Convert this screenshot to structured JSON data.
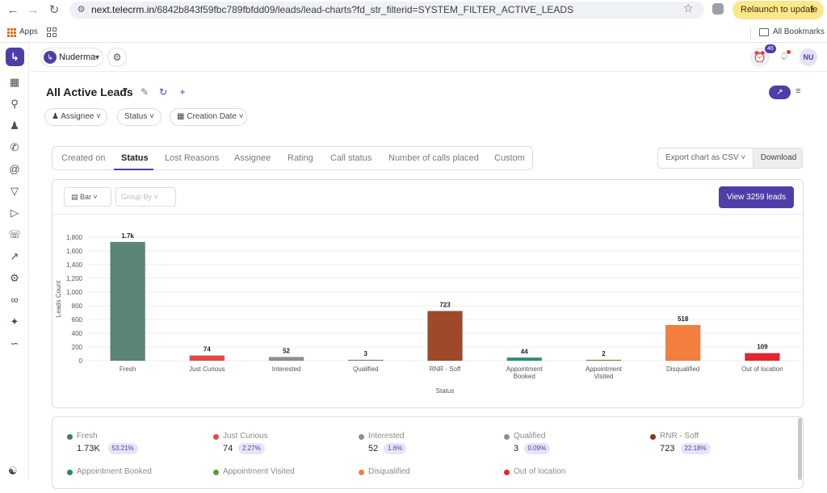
{
  "browser": {
    "url_host": "next.telecrm.in",
    "url_path": "/6842b843f59fbc789fbfdd09/leads/lead-charts?fd_str_filterid=SYSTEM_FILTER_ACTIVE_LEADS",
    "relaunch_label": "Relaunch to update",
    "bookmarks": {
      "apps_label": "Apps",
      "all_bookmarks_label": "All Bookmarks"
    }
  },
  "header": {
    "workspace_name": "Nuderma",
    "alarm_count": "46",
    "user_initials": "NU"
  },
  "page": {
    "title": "All Active Leads",
    "filters": [
      "Assignee",
      "Status",
      "Creation Date"
    ]
  },
  "tabs": {
    "items": [
      "Created on",
      "Status",
      "Lost Reasons",
      "Assignee",
      "Rating",
      "Call status",
      "Number of calls placed",
      "Custom"
    ],
    "active": "Status"
  },
  "export": {
    "select_label": "Export chart as CSV",
    "download_label": "Download"
  },
  "chart_toolbar": {
    "chart_type_label": "Bar",
    "group_by_placeholder": "Group By",
    "view_leads_label": "View 3259 leads"
  },
  "chart_data": {
    "type": "bar",
    "xlabel": "Status",
    "ylabel": "Leads Count",
    "ylim": [
      0,
      1800
    ],
    "yticks": [
      "0",
      "200",
      "400",
      "600",
      "800",
      "1,000",
      "1,200",
      "1,400",
      "1,600",
      "1,800"
    ],
    "categories": [
      "Fresh",
      "Just Curious",
      "Interested",
      "Qualified",
      "RNR - Soff",
      "Appointment Booked",
      "Appointment Visited",
      "Disqualified",
      "Out of location"
    ],
    "category_lines": [
      [
        "Fresh"
      ],
      [
        "Just Curious"
      ],
      [
        "Interested"
      ],
      [
        "Qualified"
      ],
      [
        "RNR - Soff"
      ],
      [
        "Appointment",
        "Booked"
      ],
      [
        "Appointment",
        "Visited"
      ],
      [
        "Disqualified"
      ],
      [
        "Out of location"
      ]
    ],
    "values": [
      1730,
      74,
      52,
      3,
      723,
      44,
      2,
      518,
      109
    ],
    "data_labels": [
      "1.7k",
      "74",
      "52",
      "3",
      "723",
      "44",
      "2",
      "518",
      "109"
    ],
    "colors": [
      "#5a8577",
      "#e5493f",
      "#8f8f8f",
      "#8f8f8f",
      "#9e4a2a",
      "#2f8f7a",
      "#6ea13e",
      "#f37f3f",
      "#e2262f"
    ],
    "grid": true,
    "legend": "bottom"
  },
  "legend": {
    "items": [
      {
        "name": "Fresh",
        "value": "1.73K",
        "pct": "53.21%",
        "color": "#3e7b68"
      },
      {
        "name": "Just Curious",
        "value": "74",
        "pct": "2.27%",
        "color": "#e5493f"
      },
      {
        "name": "Interested",
        "value": "52",
        "pct": "1.6%",
        "color": "#8f8f8f"
      },
      {
        "name": "Qualified",
        "value": "3",
        "pct": "0.09%",
        "color": "#8f8f8f"
      },
      {
        "name": "RNR - Soff",
        "value": "723",
        "pct": "22.18%",
        "color": "#8a3a1a"
      },
      {
        "name": "Appointment Booked",
        "value": "",
        "pct": "",
        "color": "#1f8a74"
      },
      {
        "name": "Appointment Visited",
        "value": "",
        "pct": "",
        "color": "#5a9e2f"
      },
      {
        "name": "Disqualified",
        "value": "",
        "pct": "",
        "color": "#f37f3f"
      },
      {
        "name": "Out of location",
        "value": "",
        "pct": "",
        "color": "#e2262f"
      }
    ]
  }
}
